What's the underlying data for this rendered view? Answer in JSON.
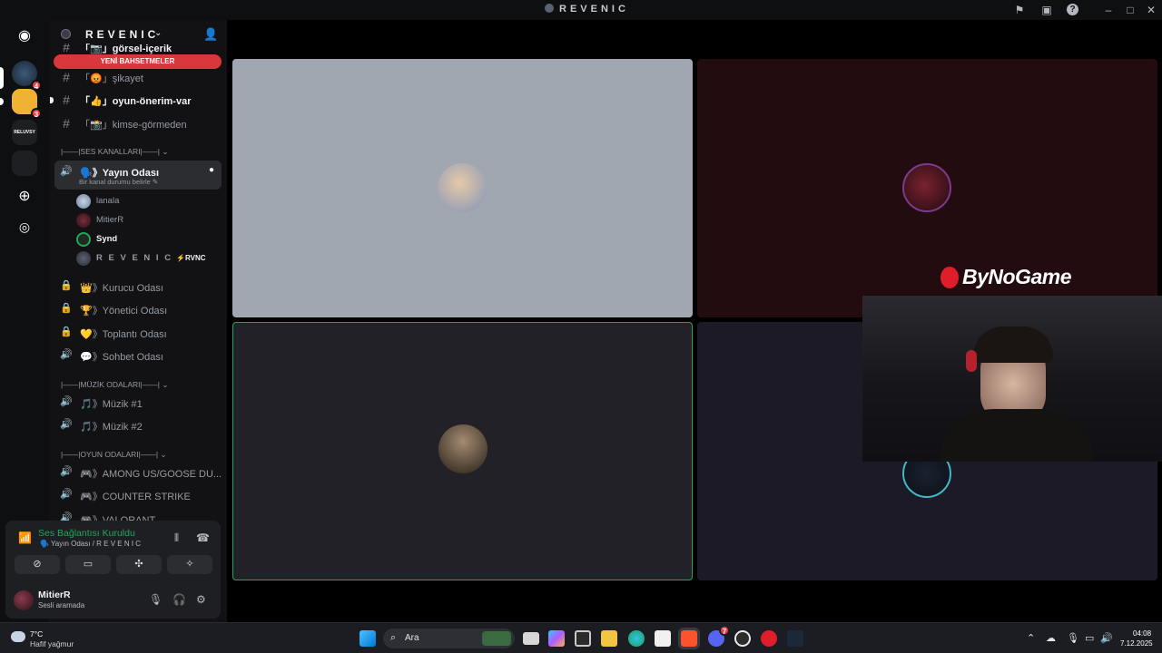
{
  "window": {
    "title": "REVENIC"
  },
  "rail": {
    "badges": [
      "4",
      "3"
    ],
    "folder_label": "RELUVSY"
  },
  "server": {
    "name": "REVENIC",
    "mention_pill": "YENİ BAHSETMELER"
  },
  "text_channels": [
    {
      "label": "「📷」görsel-içerik"
    },
    {
      "label": "「😡」şikayet"
    },
    {
      "label": "「👍」oyun-önerim-var"
    },
    {
      "label": "「📸」kimse-görmeden"
    }
  ],
  "categories": {
    "voice": "|——|SES KANALLARI|——|",
    "music": "|——|MÜZİK ODALARI|——|",
    "games": "|——|OYUN ODALARI|——|"
  },
  "active_voice": {
    "label": "🗣️》Yayın Odası",
    "status_hint": "Bir kanal durumu belirle ✎"
  },
  "members": [
    {
      "name": "lanala"
    },
    {
      "name": "MitierR"
    },
    {
      "name": "Synd"
    },
    {
      "name": "R E V E N I C",
      "tag": "⚡RVNC"
    }
  ],
  "voice_channels": [
    {
      "label": "👑》Kurucu Odası"
    },
    {
      "label": "🏆》Yönetici Odası"
    },
    {
      "label": "💛》Toplantı Odası"
    },
    {
      "label": "💬》Sohbet Odası"
    }
  ],
  "music_channels": [
    {
      "label": "🎵》Müzik #1"
    },
    {
      "label": "🎵》Müzik #2"
    }
  ],
  "game_channels": [
    {
      "label": "🎮》AMONG US/GOOSE DU..."
    },
    {
      "label": "🎮》COUNTER STRIKE"
    },
    {
      "label": "🎮》VALORANT"
    }
  ],
  "voice_panel": {
    "status": "Ses Bağlantısı Kuruldu",
    "location": "🗣️ Yayın Odası / R E V E N I C"
  },
  "user": {
    "name": "MitierR",
    "status": "Sesli aramada"
  },
  "stage": {
    "overlay_brand": "ByNoGame"
  },
  "colors": {
    "accent_green": "#23a55a",
    "mention_red": "#da373c",
    "brand_red": "#e01d2b"
  },
  "taskbar": {
    "weather_temp": "7°C",
    "weather_cond": "Hafif yağmur",
    "search_placeholder": "Ara",
    "time": "04:08",
    "date": "7.12.2025",
    "discord_badge": "7"
  }
}
